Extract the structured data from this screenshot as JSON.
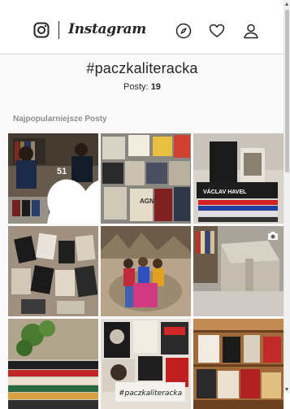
{
  "header": {
    "wordmark": "Instagram",
    "icons": [
      "instagram-logo-icon",
      "compass-icon",
      "heart-icon",
      "profile-icon"
    ]
  },
  "tag": {
    "title": "#paczkaliteracka",
    "posts_label": "Posty:",
    "posts_count": "19"
  },
  "section": {
    "top_posts_label": "Najpopularniejsze Posty"
  },
  "grid": {
    "tiles": [
      {
        "id": "post-1",
        "hovered": true,
        "likes": "51",
        "comments": "0"
      },
      {
        "id": "post-2",
        "overlay_text": "AGNES"
      },
      {
        "id": "post-3",
        "overlay_text": "VÁCLAV HAVEL"
      },
      {
        "id": "post-4"
      },
      {
        "id": "post-5"
      },
      {
        "id": "post-6",
        "badge": "camera-icon"
      },
      {
        "id": "post-7"
      },
      {
        "id": "post-8",
        "overlay_text": "#paczkaliteracka"
      },
      {
        "id": "post-9"
      }
    ]
  },
  "colors": {
    "text": "#262626",
    "secondary": "#8e8e8e",
    "divider": "#dbdbdb",
    "background": "#fafafa"
  }
}
